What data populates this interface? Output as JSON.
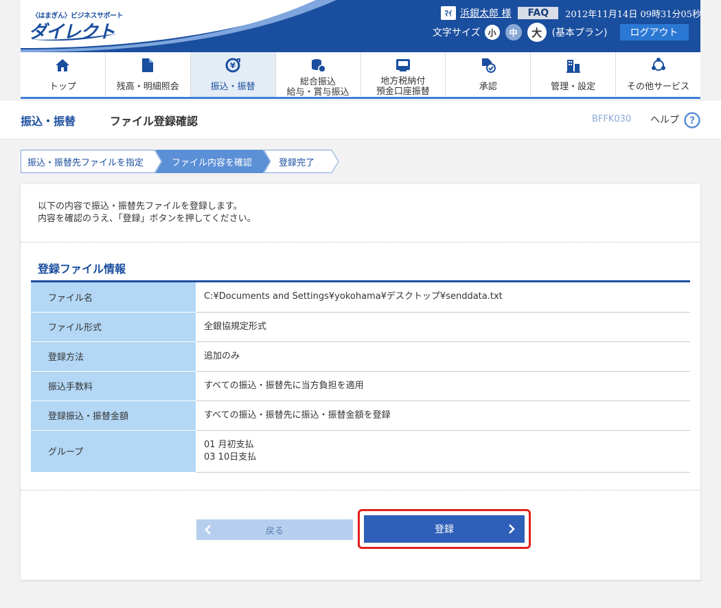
{
  "header": {
    "logo_small": "〈はまぎん〉ビジネスサポート",
    "logo_big": "ダイレクト",
    "user_icon_text": "ﾏｲ",
    "user_name": "浜銀太郎 様",
    "faq": "FAQ",
    "datetime": "2012年11月14日 09時31分05秒",
    "font_size_label": "文字サイズ",
    "font_small": "小",
    "font_medium": "中",
    "font_large": "大",
    "plan": "(基本プラン)",
    "logout": "ログアウト",
    "colors": {
      "brand": "#1a4e9e",
      "accent": "#2b78d4"
    }
  },
  "nav": {
    "items": [
      {
        "label": "トップ",
        "icon": "home-icon"
      },
      {
        "label": "残高・明細照会",
        "icon": "document-icon"
      },
      {
        "label": "振込・振替",
        "icon": "yen-transfer-icon"
      },
      {
        "label_line1": "総合振込",
        "label_line2": "給与・賞与振込",
        "icon": "coins-icon"
      },
      {
        "label_line1": "地方税納付",
        "label_line2": "預金口座振替",
        "icon": "tax-icon"
      },
      {
        "label": "承認",
        "icon": "approval-icon"
      },
      {
        "label": "管理・設定",
        "icon": "settings-building-icon"
      },
      {
        "label": "その他サービス",
        "icon": "services-icon"
      }
    ]
  },
  "title_bar": {
    "section": "振込・振替",
    "page": "ファイル登録確認",
    "screen_id": "BFFK030",
    "help": "ヘルプ"
  },
  "steps": [
    {
      "label": "振込・振替先ファイルを指定",
      "state": "done"
    },
    {
      "label": "ファイル内容を確認",
      "state": "current"
    },
    {
      "label": "登録完了",
      "state": "pending"
    }
  ],
  "panel": {
    "intro_line1": "以下の内容で振込・振替先ファイルを登録します。",
    "intro_line2": "内容を確認のうえ、「登録」ボタンを押してください。",
    "section_title": "登録ファイル情報",
    "rows": [
      {
        "label": "ファイル名",
        "value": "C:¥Documents and Settings¥yokohama¥デスクトップ¥senddata.txt"
      },
      {
        "label": "ファイル形式",
        "value": "全銀協規定形式"
      },
      {
        "label": "登録方法",
        "value": "追加のみ"
      },
      {
        "label": "振込手数料",
        "value": "すべての振込・振替先に当方負担を適用"
      },
      {
        "label": "登録振込・振替金額",
        "value": "すべての振込・振替先に振込・振替金額を登録"
      },
      {
        "label": "グループ",
        "value_line1": "01 月初支払",
        "value_line2": "03 10日支払"
      }
    ],
    "back_button": "戻る",
    "register_button": "登録"
  }
}
